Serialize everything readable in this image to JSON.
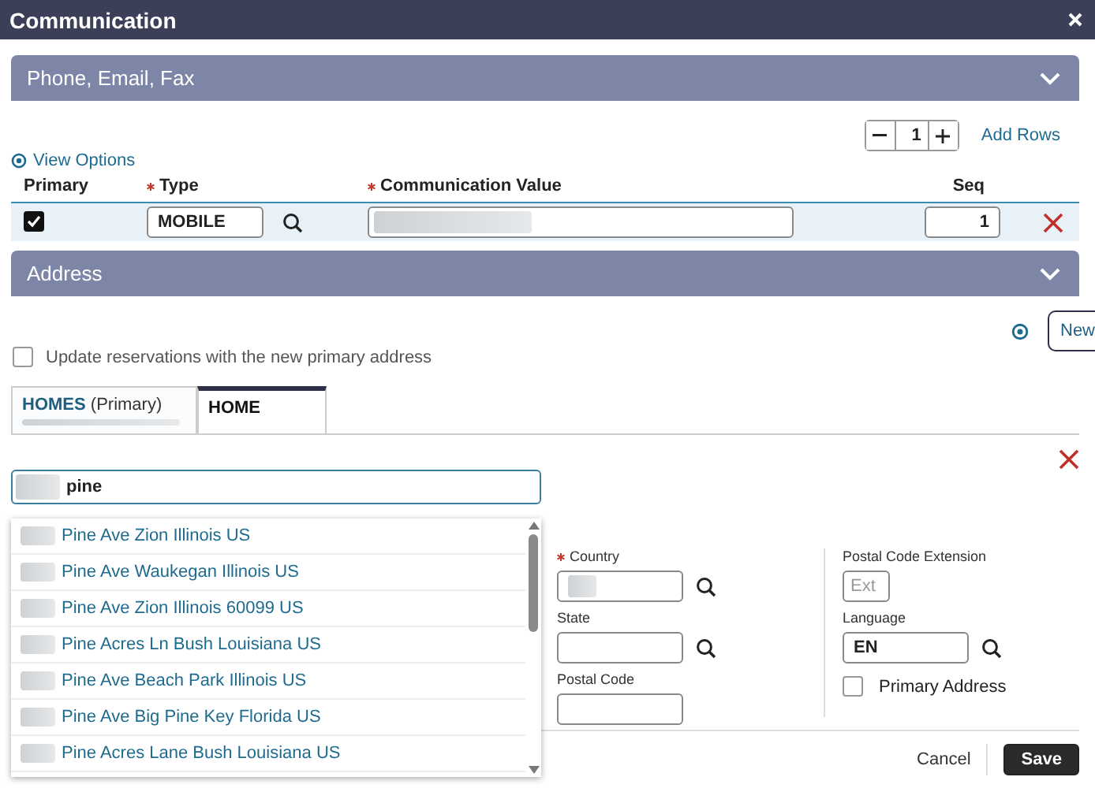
{
  "window": {
    "title": "Communication"
  },
  "phone_section": {
    "title": "Phone, Email, Fax"
  },
  "rows_stepper": {
    "value": "1",
    "action": "Add Rows"
  },
  "view_options": "View Options",
  "columns": [
    {
      "label": "Primary",
      "required": false
    },
    {
      "label": "Type",
      "required": true
    },
    {
      "label": "Communication Value",
      "required": true
    },
    {
      "label": "Seq",
      "required": false
    }
  ],
  "communications": [
    {
      "primary": true,
      "type": "MOBILE",
      "seq": "1"
    }
  ],
  "address_section": {
    "title": "Address"
  },
  "new_button": "New",
  "update_reservations": {
    "label": "Update reservations with the new primary address",
    "checked": false
  },
  "address_tabs": [
    {
      "label": "HOMES",
      "note": "(Primary)",
      "selected": false
    },
    {
      "label": "HOME",
      "selected": true
    }
  ],
  "search": {
    "value": "pine"
  },
  "suggestions": [
    "Pine Ave Zion Illinois US",
    "Pine Ave Waukegan Illinois US",
    "Pine Ave Zion Illinois 60099 US",
    "Pine Acres Ln Bush Louisiana US",
    "Pine Ave Beach Park Illinois US",
    "Pine Ave Big Pine Key Florida US",
    "Pine Acres Lane Bush Louisiana US"
  ],
  "form_columns": [
    [
      {
        "label": "Country",
        "required": true,
        "kind": "lookup"
      },
      {
        "label": "State",
        "required": false,
        "kind": "lookup"
      },
      {
        "label": "Postal Code",
        "required": false,
        "kind": "text"
      }
    ],
    [
      {
        "label": "Postal Code Extension",
        "required": false,
        "kind": "short",
        "placeholder": "Ext"
      },
      {
        "label": "Language",
        "required": false,
        "kind": "lookup",
        "value": "EN"
      },
      {
        "label": "Primary Address",
        "kind": "checkbox",
        "checked": false
      }
    ]
  ],
  "buttons": [
    {
      "label": "Cancel",
      "kind": "plain"
    },
    {
      "label": "Save",
      "kind": "primary"
    }
  ]
}
